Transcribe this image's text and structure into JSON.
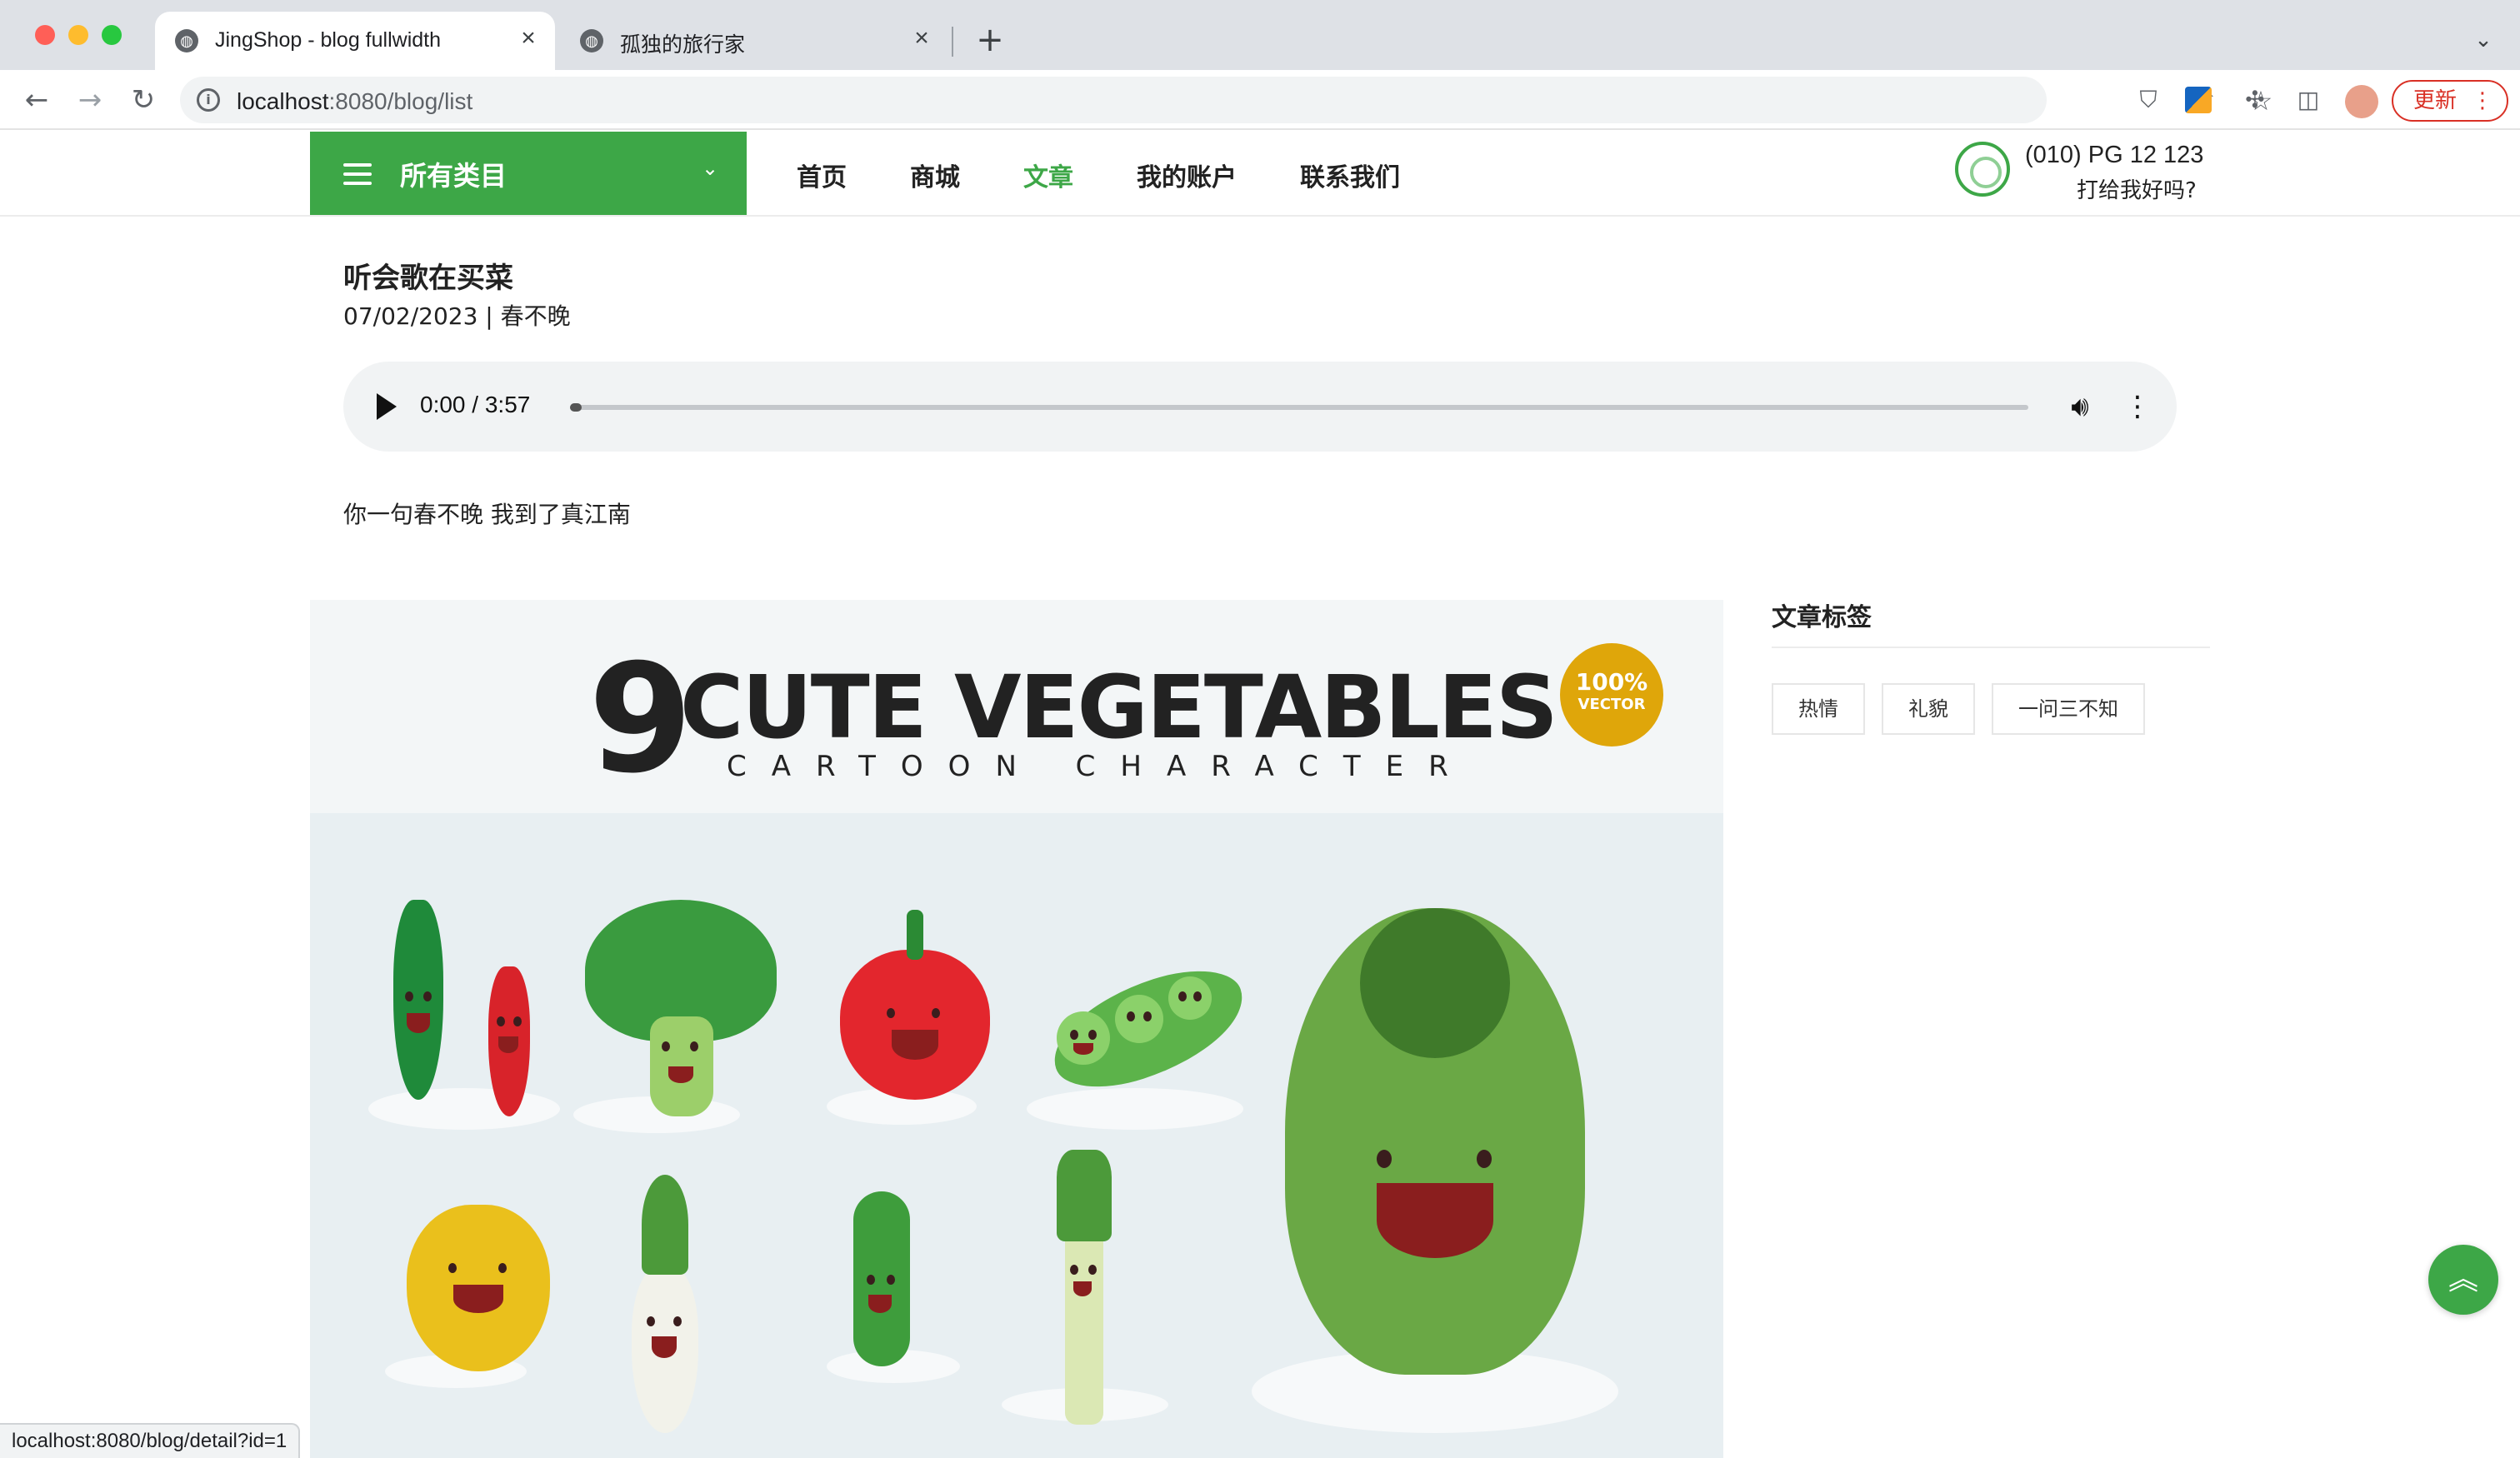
{
  "browser": {
    "tabs": [
      {
        "title": "JingShop - blog fullwidth",
        "active": true
      },
      {
        "title": "孤独的旅行家",
        "active": false
      }
    ],
    "url_host": "localhost",
    "url_path": ":8080/blog/list",
    "update_label": "更新",
    "status_url": "localhost:8080/blog/detail?id=1"
  },
  "header": {
    "all_categories": "所有类目",
    "nav": [
      "首页",
      "商城",
      "文章",
      "我的账户",
      "联系我们"
    ],
    "active_nav": "文章",
    "phone": "(010) PG 12 123",
    "phone_sub": "打给我好吗?"
  },
  "post": {
    "title": "听会歌在买菜",
    "meta": "07/02/2023 | 春不晚",
    "audio": {
      "current": "0:00",
      "duration": "3:57",
      "progress": 0.0
    },
    "excerpt": "你一句春不晚 我到了真江南"
  },
  "hero": {
    "number": "9",
    "title": "CUTE VEGETABLES",
    "subtitle": "CARTOON CHARACTER",
    "badge_top": "100%",
    "badge_bottom": "VECTOR"
  },
  "sidebar": {
    "title": "文章标签",
    "tags": [
      "热情",
      "礼貌",
      "一问三不知"
    ]
  },
  "colors": {
    "brand_green": "#3da747",
    "badge_gold": "#dfa60a"
  }
}
